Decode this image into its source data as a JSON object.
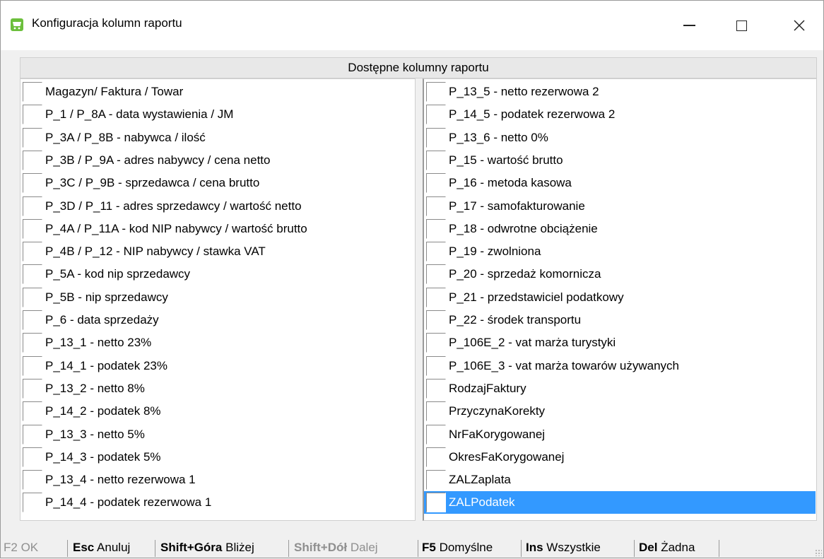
{
  "window": {
    "title": "Konfiguracja kolumn raportu",
    "minimize_symbol": "—",
    "maximize_symbol": "□",
    "close_symbol": "✕"
  },
  "panel": {
    "header": "Dostępne kolumny raportu"
  },
  "left_items": [
    {
      "label": "Magazyn/ Faktura / Towar",
      "checked": false
    },
    {
      "label": "P_1 / P_8A - data wystawienia / JM",
      "checked": false
    },
    {
      "label": "P_3A / P_8B - nabywca / ilość",
      "checked": false
    },
    {
      "label": "P_3B / P_9A - adres nabywcy / cena netto",
      "checked": false
    },
    {
      "label": "P_3C / P_9B - sprzedawca / cena brutto",
      "checked": false
    },
    {
      "label": "P_3D / P_11 - adres sprzedawcy / wartość netto",
      "checked": false
    },
    {
      "label": "P_4A / P_11A - kod NIP nabywcy / wartość brutto",
      "checked": false
    },
    {
      "label": "P_4B / P_12 - NIP nabywcy / stawka VAT",
      "checked": false
    },
    {
      "label": "P_5A - kod nip sprzedawcy",
      "checked": false
    },
    {
      "label": "P_5B - nip sprzedawcy",
      "checked": false
    },
    {
      "label": "P_6 - data sprzedaży",
      "checked": false
    },
    {
      "label": "P_13_1 - netto 23%",
      "checked": false
    },
    {
      "label": "P_14_1 - podatek  23%",
      "checked": false
    },
    {
      "label": "P_13_2 - netto 8%",
      "checked": false
    },
    {
      "label": "P_14_2 - podatek 8%",
      "checked": false
    },
    {
      "label": "P_13_3 - netto 5%",
      "checked": false
    },
    {
      "label": "P_14_3 - podatek 5%",
      "checked": false
    },
    {
      "label": "P_13_4 - netto rezerwowa 1",
      "checked": false
    },
    {
      "label": "P_14_4 - podatek rezerwowa 1",
      "checked": false
    }
  ],
  "right_items": [
    {
      "label": "P_13_5 - netto rezerwowa 2",
      "checked": false
    },
    {
      "label": "P_14_5 - podatek rezerwowa 2",
      "checked": false
    },
    {
      "label": "P_13_6 - netto 0%",
      "checked": false
    },
    {
      "label": "P_15 - wartość brutto",
      "checked": false
    },
    {
      "label": "P_16 - metoda kasowa",
      "checked": false
    },
    {
      "label": "P_17 - samofakturowanie",
      "checked": false
    },
    {
      "label": "P_18 - odwrotne obciążenie",
      "checked": false
    },
    {
      "label": "P_19 - zwolniona",
      "checked": false
    },
    {
      "label": "P_20 - sprzedaż komornicza",
      "checked": false
    },
    {
      "label": "P_21 - przedstawiciel podatkowy",
      "checked": false
    },
    {
      "label": "P_22 - środek transportu",
      "checked": false
    },
    {
      "label": "P_106E_2 - vat marża turystyki",
      "checked": false
    },
    {
      "label": "P_106E_3 - vat marża towarów używanych",
      "checked": false
    },
    {
      "label": "RodzajFaktury",
      "checked": false
    },
    {
      "label": "PrzyczynaKorekty",
      "checked": false
    },
    {
      "label": "NrFaKorygowanej",
      "checked": false
    },
    {
      "label": "OkresFaKorygowanej",
      "checked": false
    },
    {
      "label": "ZALZaplata",
      "checked": false
    },
    {
      "label": "ZALPodatek",
      "checked": false,
      "selected": true
    }
  ],
  "statusbar": {
    "f2_key": "F2",
    "f2_label": "OK",
    "esc_key": "Esc",
    "esc_label": "Anuluj",
    "shift_up_key": "Shift+Góra",
    "shift_up_label": "Bliżej",
    "shift_down_key": "Shift+Dół",
    "shift_down_label": "Dalej",
    "f5_key": "F5",
    "f5_label": "Domyślne",
    "ins_key": "Ins",
    "ins_label": "Wszystkie",
    "del_key": "Del",
    "del_label": "Żadna"
  },
  "colors": {
    "selection": "#3399ff",
    "app_icon": "#6cbf3c"
  }
}
